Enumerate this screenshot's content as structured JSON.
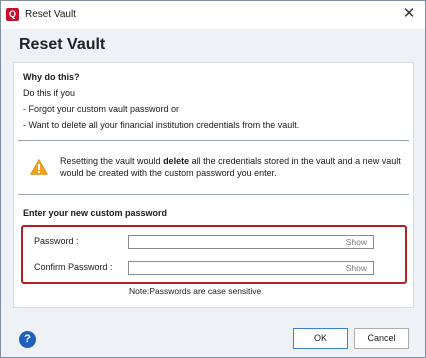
{
  "window": {
    "title": "Reset Vault"
  },
  "heading": "Reset Vault",
  "why": {
    "title": "Why do this?",
    "lines": [
      "Do this if you",
      "- Forgot your custom vault password or",
      "- Want to delete all your financial institution credentials from the vault."
    ]
  },
  "warning": {
    "before": "Resetting the vault would ",
    "bold": "delete",
    "after": " all the credentials stored in the vault and a new vault would be created with the custom password you enter."
  },
  "enter_title": "Enter your new custom password",
  "fields": {
    "password_label": "Password :",
    "confirm_label": "Confirm Password :",
    "show_label": "Show"
  },
  "note": "Note:Passwords are case sensitive",
  "buttons": {
    "ok_label": "OK",
    "cancel_label": "Cancel"
  },
  "colors": {
    "accent": "#b22222",
    "help": "#1f5fbf",
    "warning": "#f0a21a"
  }
}
